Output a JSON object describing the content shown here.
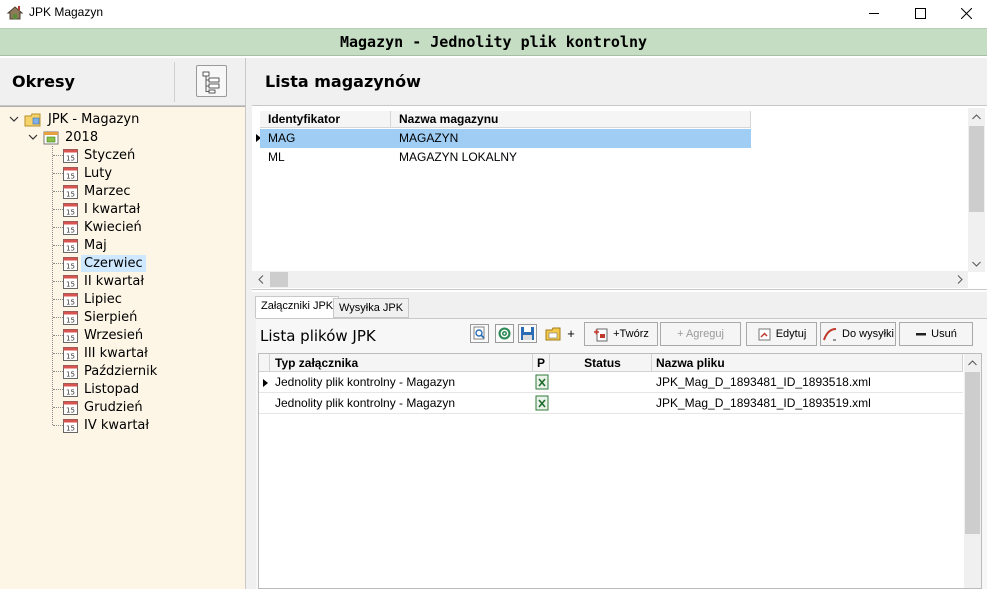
{
  "window": {
    "title": "JPK Magazyn"
  },
  "banner": {
    "title": "Magazyn - Jednolity plik kontrolny"
  },
  "left": {
    "title": "Okresy",
    "tree": {
      "root": "JPK - Magazyn",
      "year": "2018",
      "periods": [
        "Styczeń",
        "Luty",
        "Marzec",
        "I kwartał",
        "Kwiecień",
        "Maj",
        "Czerwiec",
        "II kwartał",
        "Lipiec",
        "Sierpień",
        "Wrzesień",
        "III kwartał",
        "Październik",
        "Listopad",
        "Grudzień",
        "IV kwartał"
      ],
      "selected": "Czerwiec",
      "calendar_label": "15"
    }
  },
  "right": {
    "title": "Lista magazynów",
    "grid": {
      "columns": [
        "Identyfikator",
        "Nazwa magazynu"
      ],
      "rows": [
        {
          "id": "MAG",
          "name": "MAGAZYN",
          "selected": true
        },
        {
          "id": "ML",
          "name": "MAGAZYN LOKALNY",
          "selected": false
        }
      ]
    }
  },
  "bottom": {
    "tabs": [
      "Załączniki JPK",
      "Wysyłka JPK"
    ],
    "active_tab": "Załączniki JPK",
    "files_title": "Lista plików JPK",
    "toolbar": {
      "add_label": "+",
      "create_label": "+Twórz",
      "aggregate_label": "+ Agreguj",
      "edit_label": "Edytuj",
      "send_label": "Do wysyłki",
      "delete_label": "Usuń"
    },
    "files": {
      "columns": [
        "Typ załącznika",
        "P",
        "Status",
        "Nazwa pliku"
      ],
      "rows": [
        {
          "type": "Jednolity plik kontrolny - Magazyn",
          "status": "",
          "file": "JPK_Mag_D_1893481_ID_1893518.xml",
          "current": true
        },
        {
          "type": "Jednolity plik kontrolny - Magazyn",
          "status": "",
          "file": "JPK_Mag_D_1893481_ID_1893519.xml",
          "current": false
        }
      ]
    }
  },
  "colors": {
    "banner": "#c5dec3",
    "tree_bg": "#fdf6e6",
    "selection": "#9fcdf4"
  }
}
